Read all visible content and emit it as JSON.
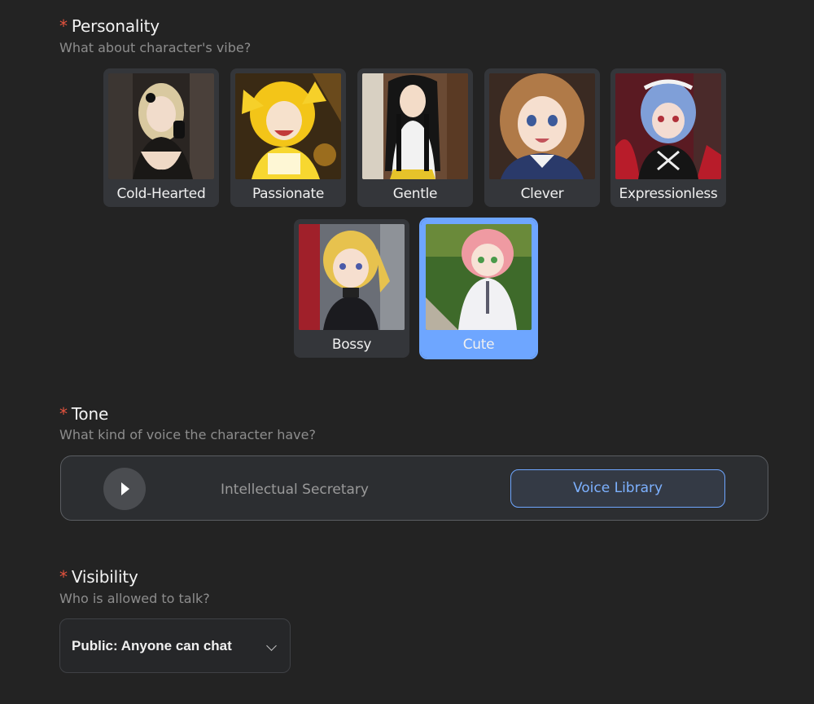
{
  "personality": {
    "title": "Personality",
    "required_mark": "*",
    "subtitle": "What about character's vibe?",
    "options": [
      {
        "label": "Cold-Hearted",
        "selected": false
      },
      {
        "label": "Passionate",
        "selected": false
      },
      {
        "label": "Gentle",
        "selected": false
      },
      {
        "label": "Clever",
        "selected": false
      },
      {
        "label": "Expressionless",
        "selected": false
      },
      {
        "label": "Bossy",
        "selected": false
      },
      {
        "label": "Cute",
        "selected": true
      }
    ]
  },
  "tone": {
    "title": "Tone",
    "required_mark": "*",
    "subtitle": "What kind of voice the character have?",
    "voice_name": "Intellectual Secretary",
    "voice_library_label": "Voice Library"
  },
  "visibility": {
    "title": "Visibility",
    "required_mark": "*",
    "subtitle": "Who is allowed to talk?",
    "selected_value": "Public: Anyone can chat"
  },
  "colors": {
    "background": "#232323",
    "accent": "#6ea6ff",
    "required": "#e5533e"
  }
}
